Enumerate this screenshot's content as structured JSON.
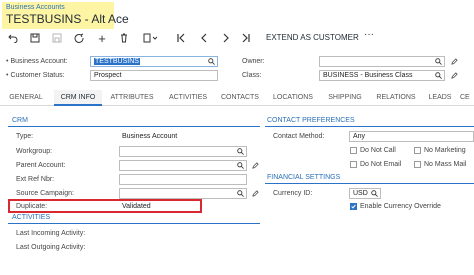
{
  "header": {
    "breadcrumb": "Business Accounts",
    "title": "TESTBUSINS - Alt Ace"
  },
  "toolbar": {
    "extend_label": "EXTEND AS CUSTOMER",
    "more_label": "···",
    "plus_label": "+"
  },
  "form": {
    "business_account": {
      "label": "Business Account:",
      "value": "TESTBUSINS"
    },
    "owner": {
      "label": "Owner:",
      "value": ""
    },
    "customer_status": {
      "label": "Customer Status:",
      "value": "Prospect"
    },
    "class": {
      "label": "Class:",
      "value": "BUSINESS - Business Class"
    }
  },
  "tabs": [
    {
      "label": "GENERAL"
    },
    {
      "label": "CRM INFO"
    },
    {
      "label": "ATTRIBUTES"
    },
    {
      "label": "ACTIVITIES"
    },
    {
      "label": "CONTACTS"
    },
    {
      "label": "LOCATIONS"
    },
    {
      "label": "SHIPPING"
    },
    {
      "label": "RELATIONS"
    },
    {
      "label": "LEADS"
    },
    {
      "label": "CE"
    }
  ],
  "crm": {
    "section": "CRM",
    "type": {
      "label": "Type:",
      "value": "Business Account"
    },
    "workgroup": {
      "label": "Workgroup:",
      "value": ""
    },
    "parent_account": {
      "label": "Parent Account:",
      "value": ""
    },
    "ext_ref": {
      "label": "Ext Ref Nbr:",
      "value": ""
    },
    "source_campaign": {
      "label": "Source Campaign:",
      "value": ""
    },
    "duplicate": {
      "label": "Duplicate:",
      "value": "Validated"
    }
  },
  "contact_prefs": {
    "section": "CONTACT PREFERENCES",
    "method": {
      "label": "Contact Method:",
      "value": "Any"
    },
    "do_not_call": "Do Not Call",
    "no_marketing": "No Marketing",
    "do_not_email": "Do Not Email",
    "no_mass_mail": "No Mass Mail"
  },
  "financial": {
    "section": "FINANCIAL SETTINGS",
    "currency": {
      "label": "Currency ID:",
      "value": "USD"
    },
    "enable_override": {
      "label": "Enable Currency Override",
      "checked": true
    }
  },
  "activities": {
    "section": "ACTIVITIES",
    "last_incoming": "Last Incoming Activity:",
    "last_outgoing": "Last Outgoing Activity:"
  }
}
